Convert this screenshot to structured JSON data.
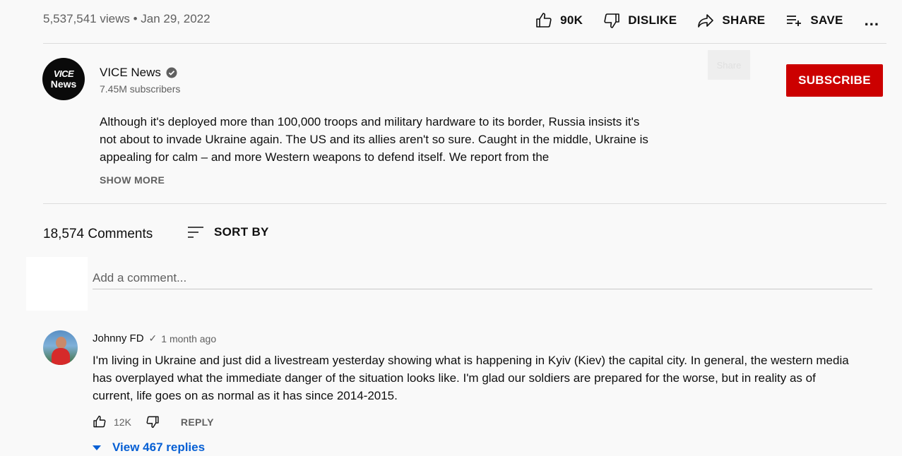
{
  "video": {
    "views_date": "5,537,541 views • Jan 29, 2022"
  },
  "actions": {
    "like_count": "90K",
    "dislike_label": "DISLIKE",
    "share_label": "SHARE",
    "save_label": "SAVE",
    "more_label": "..."
  },
  "channel": {
    "logo_line1": "VICE",
    "logo_line2": "News",
    "name": "VICE News",
    "subscribers": "7.45M subscribers",
    "subscribe_label": "SUBSCRIBE",
    "share_tooltip": "Share"
  },
  "description": {
    "text": "Although it's deployed more than 100,000 troops and military hardware to its border, Russia insists it's not about to invade Ukraine again. The US and its allies aren't so sure. Caught in the middle, Ukraine is appealing for calm – and more Western weapons to defend itself. We report from the",
    "show_more_label": "SHOW MORE"
  },
  "comments": {
    "count_label": "18,574 Comments",
    "sort_label": "SORT BY",
    "add_placeholder": "Add a comment...",
    "items": [
      {
        "author": "Johnny FD",
        "check": "✓",
        "time": "1 month ago",
        "text": "I'm living in Ukraine and just did a livestream yesterday showing what is happening in Kyiv (Kiev) the capital city. In general, the western media has overplayed what the immediate danger of the situation looks like. I'm glad our soldiers are prepared for the worse, but in reality as of current, life goes on as normal as it has since 2014-2015.",
        "likes": "12K",
        "reply_label": "REPLY",
        "view_replies_label": "View 467 replies"
      }
    ]
  },
  "colors": {
    "subscribe_bg": "#cc0000",
    "link_blue": "#065fd4",
    "secondary_text": "#606060"
  }
}
